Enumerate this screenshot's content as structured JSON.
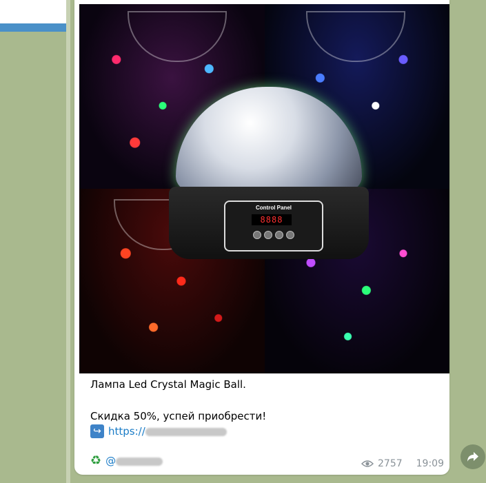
{
  "message": {
    "title_line": "Лампа Led Crystal Magic Ball.",
    "promo_line": "Скидка 50%, успей приобрести!",
    "link_prefix": "https://",
    "handle_prefix": "@",
    "views": "2757",
    "time": "19:09"
  },
  "product_image": {
    "panel_label": "Control Panel",
    "display_digits": "8888"
  },
  "icons": {
    "link_arrow": "return-arrow-icon",
    "recycle": "recycle-icon",
    "views": "eye-icon",
    "share": "share-icon"
  },
  "colors": {
    "background": "#a9b98e",
    "link": "#1a7cc7",
    "meta": "#8a9298"
  }
}
